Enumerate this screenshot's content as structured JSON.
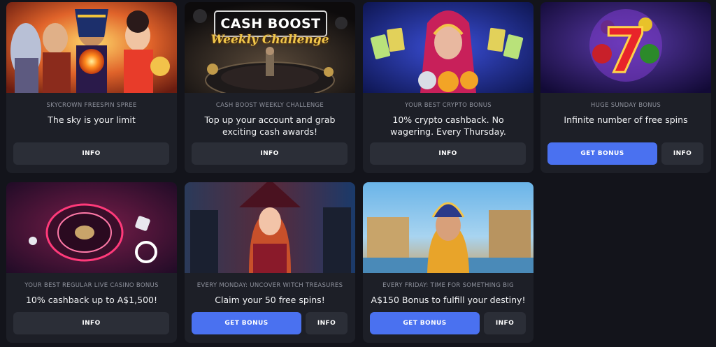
{
  "cards": [
    {
      "category": "SKYCROWN FREESPIN SPREE",
      "title": "The sky is your limit",
      "info_label": "INFO"
    },
    {
      "category": "CASH BOOST WEEKLY CHALLENGE",
      "title": "Top up your account and grab exciting cash awards!",
      "info_label": "INFO",
      "banner_title": "CASH BOOST",
      "banner_script": "Weekly Challenge"
    },
    {
      "category": "YOUR BEST CRYPTO BONUS",
      "title": "10% crypto cashback. No wagering. Every Thursday.",
      "info_label": "INFO"
    },
    {
      "category": "HUGE SUNDAY BONUS",
      "title": "Infinite number of free spins",
      "bonus_label": "GET BONUS",
      "info_label": "INFO"
    },
    {
      "category": "YOUR BEST REGULAR LIVE CASINO BONUS",
      "title": "10% cashback up to A$1,500!",
      "info_label": "INFO"
    },
    {
      "category": "EVERY MONDAY: UNCOVER WITCH TREASURES",
      "title": "Claim your 50 free spins!",
      "bonus_label": "GET BONUS",
      "info_label": "INFO"
    },
    {
      "category": "EVERY FRIDAY: TIME FOR SOMETHING BIG",
      "title": "A$150 Bonus to fulfill your destiny!",
      "bonus_label": "GET BONUS",
      "info_label": "INFO"
    }
  ],
  "colors": {
    "page_bg": "#13141b",
    "card_bg": "#1d1f27",
    "info_button": "#2b2e37",
    "bonus_button": "#4a71f0"
  }
}
